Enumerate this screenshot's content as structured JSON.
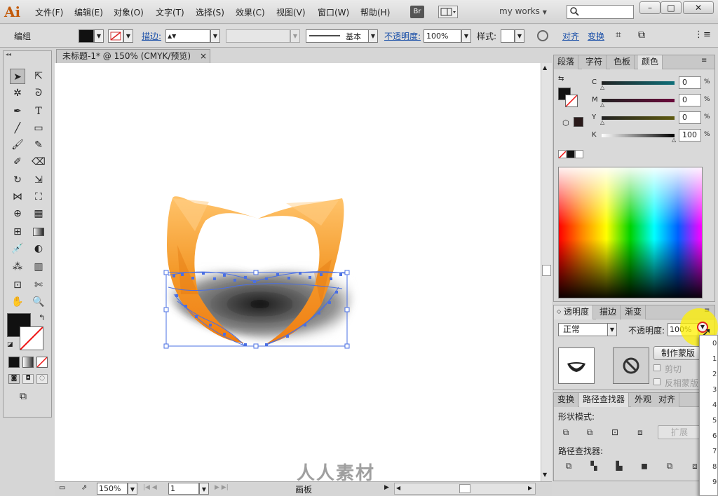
{
  "menubar": {
    "logo": "Ai",
    "items": [
      "文件(F)",
      "编辑(E)",
      "对象(O)",
      "文字(T)",
      "选择(S)",
      "效果(C)",
      "视图(V)",
      "窗口(W)",
      "帮助(H)"
    ],
    "bridge": "Br",
    "workspace": "my works",
    "window_buttons": [
      "–",
      "□",
      "✕"
    ]
  },
  "controlbar": {
    "selection_type": "编组",
    "stroke_label": "描边:",
    "stroke_style": "基本",
    "opacity_label": "不透明度:",
    "opacity_value": "100%",
    "style_label": "样式:",
    "align_link": "对齐",
    "transform_link": "变换"
  },
  "document": {
    "tab_title": "未标题-1* @ 150% (CMYK/预览)",
    "tab_close": "×",
    "zoom": "150%",
    "artboard_num": "1",
    "status": "画板"
  },
  "color_panel": {
    "tabs": [
      "段落",
      "字符",
      "色板",
      "颜色"
    ],
    "channels": [
      {
        "name": "C",
        "value": "0",
        "unit": "%"
      },
      {
        "name": "M",
        "value": "0",
        "unit": "%"
      },
      {
        "name": "Y",
        "value": "0",
        "unit": "%"
      },
      {
        "name": "K",
        "value": "100",
        "unit": "%"
      }
    ]
  },
  "transparency_panel": {
    "tabs": [
      "透明度",
      "描边",
      "渐变"
    ],
    "blend_mode": "正常",
    "opacity_label": "不透明度:",
    "opacity_value": "100%",
    "make_mask": "制作蒙版",
    "clip": "剪切",
    "invert": "反相蒙版"
  },
  "pathfinder_panel": {
    "tabs": [
      "变换",
      "路径查找器",
      "外观",
      "对齐"
    ],
    "shape_modes_label": "形状模式:",
    "expand": "扩展",
    "pathfinders_label": "路径查找器:"
  },
  "opacity_popup": {
    "items": [
      "0",
      "1",
      "2",
      "3",
      "4",
      "5",
      "6",
      "7",
      "8",
      "9"
    ]
  },
  "watermark": "人人素材",
  "colors": {
    "orange_light": "#ffb74a",
    "orange_dark": "#f08a1c",
    "selection_blue": "#4a6fe3"
  }
}
